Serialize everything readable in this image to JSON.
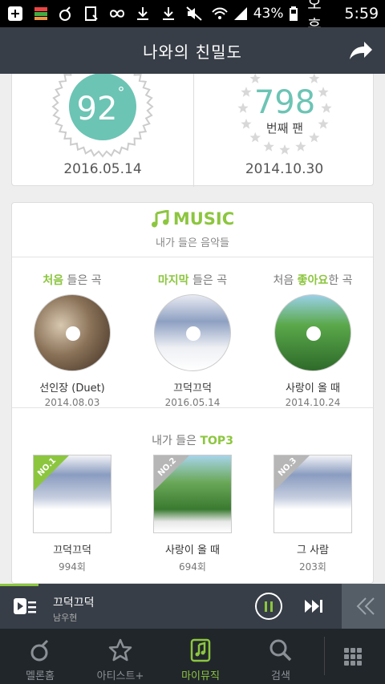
{
  "status_bar": {
    "battery": "43%",
    "ampm": "오후",
    "time": "5:59",
    "icons": [
      "add-icon",
      "app-icon",
      "melon-icon",
      "download-file-icon",
      "infinity-icon",
      "download-icon",
      "download-icon",
      "mute-icon",
      "wifi-icon",
      "signal-icon",
      "battery-icon"
    ]
  },
  "header": {
    "title": "나와의 친밀도",
    "share_icon": "share-icon"
  },
  "intimacy": {
    "score": "92",
    "score_unit": "°",
    "score_date": "2016.05.14",
    "fan_number": "798",
    "fan_label": "번째 팬",
    "fan_date": "2014.10.30"
  },
  "music": {
    "title": "MUSIC",
    "subtitle": "내가 들은 음악들",
    "firsts": [
      {
        "highlight": "처음",
        "rest": " 들은 곡",
        "song": "선인장 (Duet)",
        "date": "2014.08.03"
      },
      {
        "highlight": "마지막",
        "rest": " 들은 곡",
        "song": "끄덕끄덕",
        "date": "2016.05.14"
      },
      {
        "prefix": "처음 ",
        "highlight": "좋아요",
        "rest": "한 곡",
        "song": "사랑이 올 때",
        "date": "2014.10.24"
      }
    ],
    "top3_prefix": "내가 들은 ",
    "top3_highlight": "TOP3",
    "top3": [
      {
        "rank": "NO.1",
        "song": "끄덕끄덕",
        "count": "994회"
      },
      {
        "rank": "NO.2",
        "song": "사랑이 올 때",
        "count": "694회"
      },
      {
        "rank": "NO.3",
        "song": "그 사람",
        "count": "203회"
      }
    ]
  },
  "player": {
    "song": "끄덕끄덕",
    "artist": "남우현",
    "progress_fraction": 0.1
  },
  "nav": {
    "items": [
      {
        "label": "멜론홈",
        "icon": "melon-home-icon"
      },
      {
        "label": "아티스트+",
        "icon": "star-icon"
      },
      {
        "label": "마이뮤직",
        "icon": "my-music-icon"
      },
      {
        "label": "검색",
        "icon": "search-icon"
      }
    ],
    "active": "마이뮤직",
    "menu_icon": "grid-menu-icon"
  },
  "colors": {
    "accent": "#8cc63f",
    "teal": "#6cc4b4",
    "header_bg": "#373e47",
    "nav_bg": "#21262b"
  }
}
